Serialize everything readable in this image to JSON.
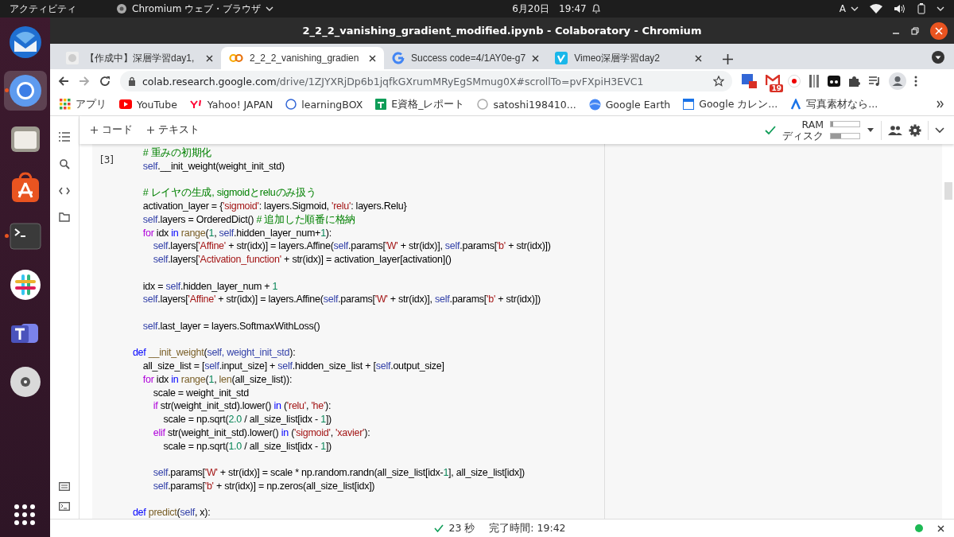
{
  "top_bar": {
    "activities": "アクティビティ",
    "app_menu": "Chromium ウェブ・ブラウザ",
    "clock": "6月20日　19:47",
    "input_method": "A"
  },
  "dock": [
    {
      "running": false,
      "selected": false
    },
    {
      "running": true,
      "selected": true
    },
    {
      "running": false,
      "selected": false
    },
    {
      "running": false,
      "selected": false
    },
    {
      "running": true,
      "selected": false
    },
    {
      "running": false,
      "selected": false
    },
    {
      "running": false,
      "selected": false
    },
    {
      "running": false,
      "selected": false
    }
  ],
  "window": {
    "title": "2_2_2_vanishing_gradient_modified.ipynb - Colaboratory - Chromium"
  },
  "tabs": [
    {
      "label": "【作成中】深層学習day1,",
      "selected": false
    },
    {
      "label": "2_2_2_vanishing_gradien",
      "selected": true
    },
    {
      "label": "Success code=4/1AY0e-g7",
      "selected": false
    },
    {
      "label": "Vimeo深層学習day2",
      "selected": false
    }
  ],
  "address_bar": {
    "host": "colab.research.google.com",
    "path": "/drive/1ZJYXRjDp6b1jqfkGXrumMRyEgSMmug0X#scrollTo=pvFXpiH3EVC1"
  },
  "extension_badge": "19",
  "bookmarks": [
    "アプリ",
    "YouTube",
    "Yahoo! JAPAN",
    "learningBOX",
    "E資格_レポート",
    "satoshi198410...",
    "Google Earth",
    "Google カレン...",
    "写真素材なら..."
  ],
  "notebook": {
    "toolbar": [
      "コード",
      "テキスト"
    ],
    "resources": [
      {
        "label": "RAM",
        "level": 0.08
      },
      {
        "label": "ディスク",
        "level": 0.35
      }
    ],
    "cell": {
      "count": "[3]",
      "lines": [
        {
          "kind": "code",
          "tokens": [
            {
              "kind": "comment",
              "text": "        # 重みの初期化"
            }
          ]
        },
        {
          "kind": "code",
          "tokens": [
            {
              "kind": "self",
              "text": "        self"
            },
            {
              "kind": "plain",
              "text": ".__init_weight(weight_init_std)"
            }
          ]
        },
        {
          "kind": "blank"
        },
        {
          "kind": "code",
          "tokens": [
            {
              "kind": "comment",
              "text": "        # レイヤの生成, sigmoidとreluのみ扱う"
            }
          ]
        },
        {
          "kind": "code",
          "tokens": [
            {
              "kind": "plain",
              "text": "        activation_layer = {"
            },
            {
              "kind": "string",
              "text": "'sigmoid'"
            },
            {
              "kind": "plain",
              "text": ": layers.Sigmoid, "
            },
            {
              "kind": "string",
              "text": "'relu'"
            },
            {
              "kind": "plain",
              "text": ": layers.Relu}"
            }
          ]
        },
        {
          "kind": "code",
          "tokens": [
            {
              "kind": "self",
              "text": "        self"
            },
            {
              "kind": "plain",
              "text": ".layers = OrderedDict() "
            },
            {
              "kind": "comment",
              "text": "# 追加した順番に格納"
            }
          ]
        },
        {
          "kind": "code",
          "tokens": [
            {
              "kind": "control",
              "text": "        for"
            },
            {
              "kind": "plain",
              "text": " idx "
            },
            {
              "kind": "keyword",
              "text": "in "
            },
            {
              "kind": "function",
              "text": "range"
            },
            {
              "kind": "plain",
              "text": "("
            },
            {
              "kind": "number",
              "text": "1"
            },
            {
              "kind": "plain",
              "text": ", "
            },
            {
              "kind": "self",
              "text": "self"
            },
            {
              "kind": "plain",
              "text": ".hidden_layer_num+"
            },
            {
              "kind": "number",
              "text": "1"
            },
            {
              "kind": "plain",
              "text": "):"
            }
          ]
        },
        {
          "kind": "code",
          "tokens": [
            {
              "kind": "self",
              "text": "            self"
            },
            {
              "kind": "plain",
              "text": ".layers["
            },
            {
              "kind": "string",
              "text": "'Affine'"
            },
            {
              "kind": "plain",
              "text": " + str(idx)] = layers.Affine("
            },
            {
              "kind": "self",
              "text": "self"
            },
            {
              "kind": "plain",
              "text": ".params["
            },
            {
              "kind": "string",
              "text": "'W'"
            },
            {
              "kind": "plain",
              "text": " + str(idx)], "
            },
            {
              "kind": "self",
              "text": "self"
            },
            {
              "kind": "plain",
              "text": ".params["
            },
            {
              "kind": "string",
              "text": "'b'"
            },
            {
              "kind": "plain",
              "text": " + str(idx)])"
            }
          ]
        },
        {
          "kind": "code",
          "tokens": [
            {
              "kind": "self",
              "text": "            self"
            },
            {
              "kind": "plain",
              "text": ".layers["
            },
            {
              "kind": "string",
              "text": "'Activation_function'"
            },
            {
              "kind": "plain",
              "text": " + str(idx)] = activation_layer[activation]()"
            }
          ]
        },
        {
          "kind": "blank"
        },
        {
          "kind": "code",
          "tokens": [
            {
              "kind": "plain",
              "text": "        idx = "
            },
            {
              "kind": "self",
              "text": "self"
            },
            {
              "kind": "plain",
              "text": ".hidden_layer_num + "
            },
            {
              "kind": "number",
              "text": "1"
            }
          ]
        },
        {
          "kind": "code",
          "tokens": [
            {
              "kind": "self",
              "text": "        self"
            },
            {
              "kind": "plain",
              "text": ".layers["
            },
            {
              "kind": "string",
              "text": "'Affine'"
            },
            {
              "kind": "plain",
              "text": " + str(idx)] = layers.Affine("
            },
            {
              "kind": "self",
              "text": "self"
            },
            {
              "kind": "plain",
              "text": ".params["
            },
            {
              "kind": "string",
              "text": "'W'"
            },
            {
              "kind": "plain",
              "text": " + str(idx)], "
            },
            {
              "kind": "self",
              "text": "self"
            },
            {
              "kind": "plain",
              "text": ".params["
            },
            {
              "kind": "string",
              "text": "'b'"
            },
            {
              "kind": "plain",
              "text": " + str(idx)])"
            }
          ]
        },
        {
          "kind": "blank"
        },
        {
          "kind": "code",
          "tokens": [
            {
              "kind": "self",
              "text": "        self"
            },
            {
              "kind": "plain",
              "text": ".last_layer = layers.SoftmaxWithLoss()"
            }
          ]
        },
        {
          "kind": "blank"
        },
        {
          "kind": "code",
          "tokens": [
            {
              "kind": "keyword",
              "text": "    def "
            },
            {
              "kind": "function",
              "text": "__init_weight"
            },
            {
              "kind": "plain",
              "text": "("
            },
            {
              "kind": "self",
              "text": "self, weight_init_std"
            },
            {
              "kind": "plain",
              "text": "):"
            }
          ]
        },
        {
          "kind": "code",
          "tokens": [
            {
              "kind": "plain",
              "text": "        all_size_list = ["
            },
            {
              "kind": "self",
              "text": "self"
            },
            {
              "kind": "plain",
              "text": ".input_size] + "
            },
            {
              "kind": "self",
              "text": "self"
            },
            {
              "kind": "plain",
              "text": ".hidden_size_list + ["
            },
            {
              "kind": "self",
              "text": "self"
            },
            {
              "kind": "plain",
              "text": ".output_size]"
            }
          ]
        },
        {
          "kind": "code",
          "tokens": [
            {
              "kind": "control",
              "text": "        for"
            },
            {
              "kind": "plain",
              "text": " idx "
            },
            {
              "kind": "keyword",
              "text": "in "
            },
            {
              "kind": "function",
              "text": "range"
            },
            {
              "kind": "plain",
              "text": "("
            },
            {
              "kind": "number",
              "text": "1"
            },
            {
              "kind": "plain",
              "text": ", "
            },
            {
              "kind": "function",
              "text": "len"
            },
            {
              "kind": "plain",
              "text": "(all_size_list)):"
            }
          ]
        },
        {
          "kind": "code",
          "tokens": [
            {
              "kind": "plain",
              "text": "            scale = weight_init_std"
            }
          ]
        },
        {
          "kind": "code",
          "tokens": [
            {
              "kind": "control",
              "text": "            if"
            },
            {
              "kind": "plain",
              "text": " str(weight_init_std).lower() "
            },
            {
              "kind": "keyword",
              "text": "in"
            },
            {
              "kind": "plain",
              "text": " ("
            },
            {
              "kind": "string",
              "text": "'relu'"
            },
            {
              "kind": "plain",
              "text": ", "
            },
            {
              "kind": "string",
              "text": "'he'"
            },
            {
              "kind": "plain",
              "text": "):"
            }
          ]
        },
        {
          "kind": "code",
          "tokens": [
            {
              "kind": "plain",
              "text": "                scale = np.sqrt("
            },
            {
              "kind": "number",
              "text": "2.0"
            },
            {
              "kind": "plain",
              "text": " / all_size_list[idx - "
            },
            {
              "kind": "number",
              "text": "1"
            },
            {
              "kind": "plain",
              "text": "])"
            }
          ]
        },
        {
          "kind": "code",
          "tokens": [
            {
              "kind": "control",
              "text": "            elif"
            },
            {
              "kind": "plain",
              "text": " str(weight_init_std).lower() "
            },
            {
              "kind": "keyword",
              "text": "in"
            },
            {
              "kind": "plain",
              "text": " ("
            },
            {
              "kind": "string",
              "text": "'sigmoid'"
            },
            {
              "kind": "plain",
              "text": ", "
            },
            {
              "kind": "string",
              "text": "'xavier'"
            },
            {
              "kind": "plain",
              "text": "):"
            }
          ]
        },
        {
          "kind": "code",
          "tokens": [
            {
              "kind": "plain",
              "text": "                scale = np.sqrt("
            },
            {
              "kind": "number",
              "text": "1.0"
            },
            {
              "kind": "plain",
              "text": " / all_size_list[idx - "
            },
            {
              "kind": "number",
              "text": "1"
            },
            {
              "kind": "plain",
              "text": "])"
            }
          ]
        },
        {
          "kind": "blank"
        },
        {
          "kind": "code",
          "tokens": [
            {
              "kind": "self",
              "text": "            self"
            },
            {
              "kind": "plain",
              "text": ".params["
            },
            {
              "kind": "string",
              "text": "'W'"
            },
            {
              "kind": "plain",
              "text": " + str(idx)] = scale * np.random.randn(all_size_list[idx-"
            },
            {
              "kind": "number",
              "text": "1"
            },
            {
              "kind": "plain",
              "text": "], all_size_list[idx])"
            }
          ]
        },
        {
          "kind": "code",
          "tokens": [
            {
              "kind": "self",
              "text": "            self"
            },
            {
              "kind": "plain",
              "text": ".params["
            },
            {
              "kind": "string",
              "text": "'b'"
            },
            {
              "kind": "plain",
              "text": " + str(idx)] = np.zeros(all_size_list[idx])"
            }
          ]
        },
        {
          "kind": "blank"
        },
        {
          "kind": "code",
          "tokens": [
            {
              "kind": "keyword",
              "text": "    def "
            },
            {
              "kind": "function",
              "text": "predict"
            },
            {
              "kind": "plain",
              "text": "("
            },
            {
              "kind": "self",
              "text": "self"
            },
            {
              "kind": "plain",
              "text": ", x):"
            }
          ]
        }
      ]
    }
  },
  "status_bar": {
    "elapsed": "23 秒",
    "finished": "完了時間: 19:42"
  }
}
